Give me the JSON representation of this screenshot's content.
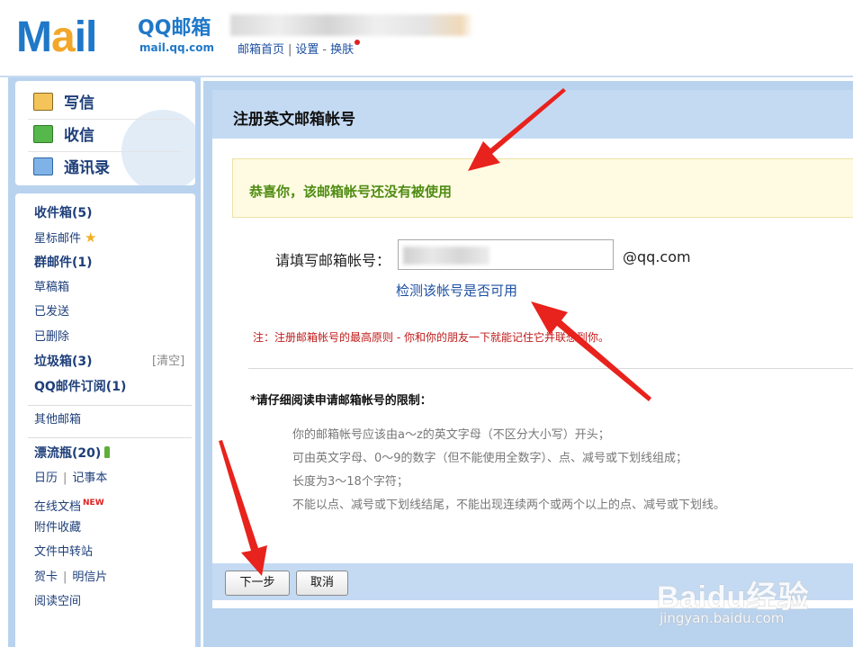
{
  "header": {
    "logo_text": [
      "M",
      "a",
      "i",
      "l"
    ],
    "logo_qq": "QQ邮箱",
    "logo_url": "mail.qq.com",
    "nav": [
      "邮箱首页",
      "设置",
      "换肤"
    ]
  },
  "quick": {
    "write": "写信",
    "receive": "收信",
    "contacts": "通讯录"
  },
  "folders": {
    "inbox": "收件箱(5)",
    "starred": "星标邮件",
    "group": "群邮件(1)",
    "drafts": "草稿箱",
    "sent": "已发送",
    "deleted": "已删除",
    "spam": "垃圾箱(3)",
    "spam_clear": "[清空]",
    "subscriptions": "QQ邮件订阅(1)",
    "other": "其他邮箱",
    "drift_bottle": "漂流瓶(20)",
    "calendar": "日历",
    "notes": "记事本",
    "online_docs": "在线文档",
    "online_docs_badge": "NEW",
    "attachments": "附件收藏",
    "file_transfer": "文件中转站",
    "greeting_card": "贺卡",
    "postcard": "明信片",
    "reading_space": "阅读空间"
  },
  "main": {
    "title": "注册英文邮箱帐号",
    "notice": "恭喜你，该邮箱帐号还没有被使用",
    "account_label": "请填写邮箱帐号：",
    "account_domain": "@qq.com",
    "check_link": "检测该帐号是否可用",
    "note": "注：注册邮箱帐号的最高原则 - 你和你的朋友一下就能记住它并联想到你。",
    "rules_title": "*请仔细阅读申请邮箱帐号的限制：",
    "rules": [
      "你的邮箱帐号应该由a～z的英文字母（不区分大小写）开头；",
      "可由英文字母、0～9的数字（但不能使用全数字）、点、减号或下划线组成；",
      "长度为3～18个字符；",
      "不能以点、减号或下划线结尾，不能出现连续两个或两个以上的点、减号或下划线。"
    ],
    "next_button": "下一步",
    "cancel_button": "取消"
  },
  "watermark": {
    "brand": "Baidu经验",
    "site": "jingyan.baidu.com"
  },
  "colors": {
    "header_blue": "#1f78c8",
    "panel_blue": "#c4daf3",
    "link_blue": "#1e50a2",
    "notice_green": "#4f8c12",
    "note_red": "#c01a1a",
    "arrow_red": "#e8221c"
  }
}
